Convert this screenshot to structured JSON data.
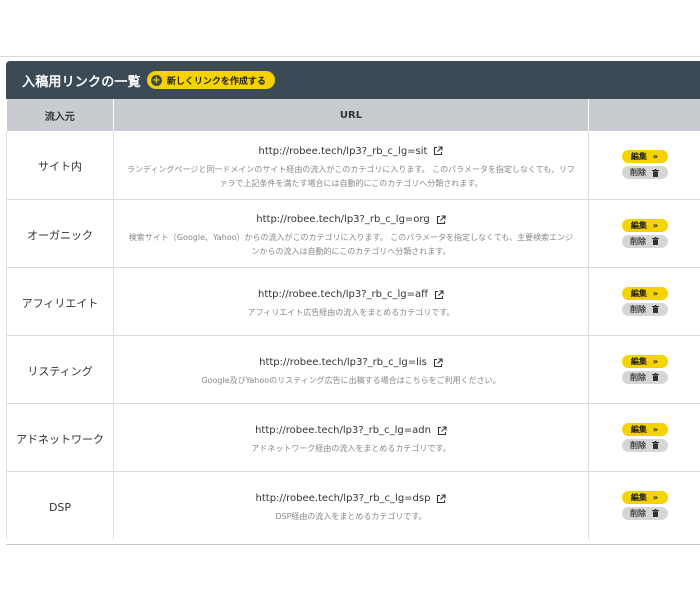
{
  "panel": {
    "title": "入稿用リンクの一覧",
    "create_button_label": "新しくリンクを作成する"
  },
  "table": {
    "headers": {
      "source": "流入元",
      "url": "URL",
      "actions": ""
    },
    "rows": [
      {
        "source": "サイト内",
        "url": "http://robee.tech/lp3?_rb_c_lg=sit",
        "description": "ランディングページと同一ドメインのサイト経由の流入がこのカテゴリに入ります。 このパラメータを指定しなくても、リファラで上記条件を満たす場合には自動的にこのカテゴリへ分類されます。"
      },
      {
        "source": "オーガニック",
        "url": "http://robee.tech/lp3?_rb_c_lg=org",
        "description": "検索サイト（Google、Yahoo）からの流入がこのカテゴリに入ります。 このパラメータを指定しなくても、主要検索エンジンからの流入は自動的にこのカテゴリへ分類されます。"
      },
      {
        "source": "アフィリエイト",
        "url": "http://robee.tech/lp3?_rb_c_lg=aff",
        "description": "アフィリエイト広告経由の流入をまとめるカテゴリです。"
      },
      {
        "source": "リスティング",
        "url": "http://robee.tech/lp3?_rb_c_lg=lis",
        "description": "Google及びYahooのリスティング広告に出稿する場合はこちらをご利用ください。"
      },
      {
        "source": "アドネットワーク",
        "url": "http://robee.tech/lp3?_rb_c_lg=adn",
        "description": "アドネットワーク経由の流入をまとめるカテゴリです。"
      },
      {
        "source": "DSP",
        "url": "http://robee.tech/lp3?_rb_c_lg=dsp",
        "description": "DSP経由の流入をまとめるカテゴリです。"
      }
    ],
    "edit_label": "編集",
    "delete_label": "削除"
  },
  "icons": {
    "create": "plus-circle-icon",
    "external": "external-link-icon",
    "edit": "double-chevron-right-icon",
    "delete": "trash-icon"
  },
  "colors": {
    "header_bg": "#3c4a56",
    "accent_yellow": "#f4d300",
    "column_header_bg": "#c8ccd1",
    "delete_button_bg": "#d6d6d6"
  }
}
